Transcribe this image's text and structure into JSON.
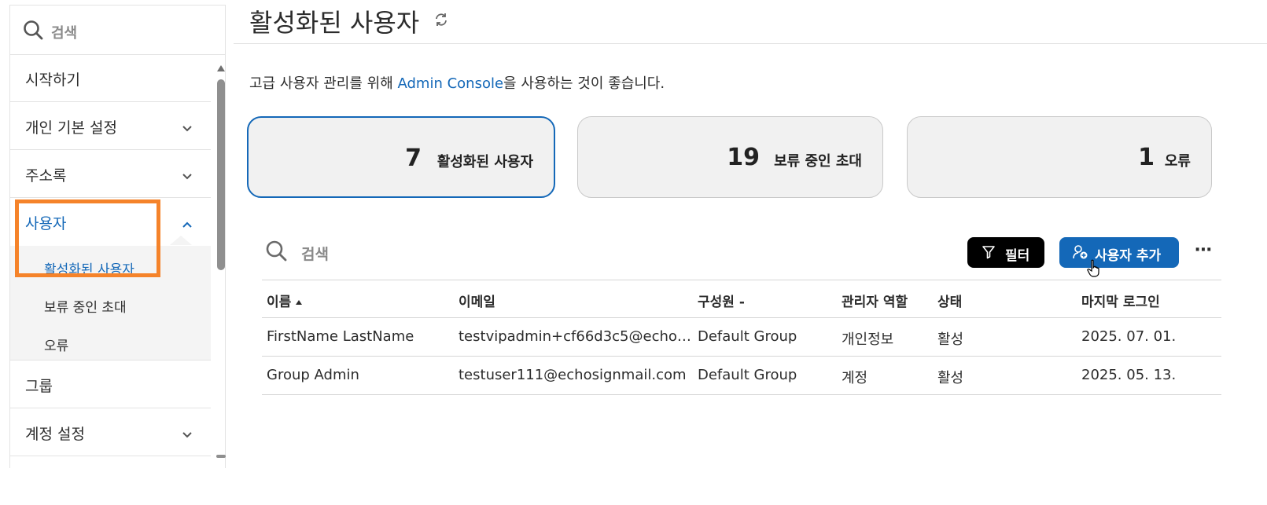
{
  "sidebar": {
    "search_placeholder": "검색",
    "items": [
      {
        "label": "시작하기"
      },
      {
        "label": "개인 기본 설정"
      },
      {
        "label": "주소록"
      },
      {
        "label": "사용자"
      },
      {
        "label": "그룹"
      },
      {
        "label": "계정 설정"
      }
    ],
    "subitems": [
      {
        "label": "활성화된 사용자"
      },
      {
        "label": "보류 중인 초대"
      },
      {
        "label": "오류"
      }
    ]
  },
  "header": {
    "title": "활성화된 사용자"
  },
  "hint": {
    "before": "고급 사용자 관리를 위해 ",
    "link": "Admin Console",
    "after": "을 사용하는 것이 좋습니다."
  },
  "cards": [
    {
      "value": "7",
      "label": "활성화된 사용자"
    },
    {
      "value": "19",
      "label": "보류 중인 초대"
    },
    {
      "value": "1",
      "label": "오류"
    }
  ],
  "toolbar": {
    "search_placeholder": "검색",
    "filter_label": "필터",
    "add_user_label": "사용자 추가",
    "more_label": "⋯"
  },
  "table": {
    "columns": [
      "이름",
      "이메일",
      "구성원 -",
      "관리자 역할",
      "상태",
      "마지막 로그인"
    ],
    "rows": [
      [
        "FirstName LastName",
        "testvipadmin+cf66d3c5@echosign...",
        "Default Group",
        "개인정보",
        "활성",
        "2025. 07. 01."
      ],
      [
        "Group Admin",
        "testuser111@echosignmail.com",
        "Default Group",
        "계정",
        "활성",
        "2025. 05. 13."
      ]
    ]
  },
  "colors": {
    "accent": "#1468b8",
    "highlight": "#f5832a"
  }
}
